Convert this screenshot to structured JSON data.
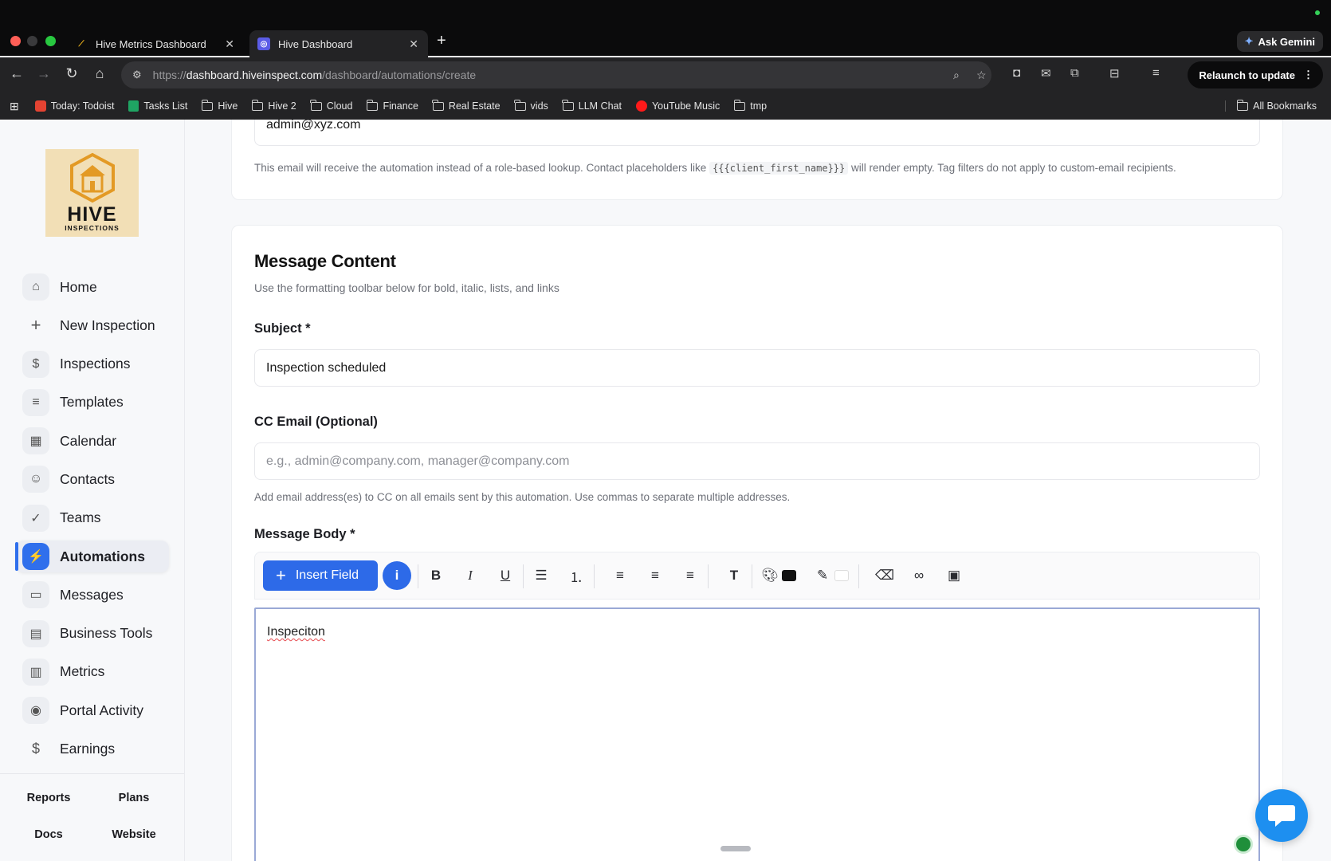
{
  "browser": {
    "tabs": [
      {
        "title": "Hive Metrics Dashboard",
        "active": false
      },
      {
        "title": "Hive Dashboard",
        "active": true
      }
    ],
    "ask_gemini": "Ask Gemini",
    "url_prefix": "https://",
    "url_domain": "dashboard.hiveinspect.com",
    "url_path": "/dashboard/automations/create",
    "relaunch": "Relaunch to update",
    "bookmarks": [
      {
        "label": "Today: Todoist",
        "icon": "todoist-icon"
      },
      {
        "label": "Tasks List",
        "icon": "sheets-icon"
      },
      {
        "label": "Hive",
        "icon": "folder-icon"
      },
      {
        "label": "Hive 2",
        "icon": "folder-icon"
      },
      {
        "label": "Cloud",
        "icon": "folder-icon"
      },
      {
        "label": "Finance",
        "icon": "folder-icon"
      },
      {
        "label": "Real Estate",
        "icon": "folder-icon"
      },
      {
        "label": "vids",
        "icon": "folder-icon"
      },
      {
        "label": "LLM Chat",
        "icon": "folder-icon"
      },
      {
        "label": "YouTube Music",
        "icon": "youtube-music-icon"
      },
      {
        "label": "tmp",
        "icon": "folder-icon"
      }
    ],
    "all_bookmarks": "All Bookmarks"
  },
  "sidebar": {
    "logo_word": "HIVE",
    "logo_sub": "INSPECTIONS",
    "items": [
      {
        "label": "Home",
        "icon": "home-icon",
        "glyph": "⌂"
      },
      {
        "label": "New Inspection",
        "icon": "plus-icon",
        "glyph": "+"
      },
      {
        "label": "Inspections",
        "icon": "dollar-doc-icon",
        "glyph": "$"
      },
      {
        "label": "Templates",
        "icon": "document-icon",
        "glyph": "≡"
      },
      {
        "label": "Calendar",
        "icon": "calendar-icon",
        "glyph": "▦"
      },
      {
        "label": "Contacts",
        "icon": "users-icon",
        "glyph": "☺"
      },
      {
        "label": "Teams",
        "icon": "user-check-icon",
        "glyph": "✓"
      },
      {
        "label": "Automations",
        "icon": "lightning-icon",
        "glyph": "⚡",
        "active": true
      },
      {
        "label": "Messages",
        "icon": "message-icon",
        "glyph": "▭"
      },
      {
        "label": "Business Tools",
        "icon": "briefcase-icon",
        "glyph": "▤"
      },
      {
        "label": "Metrics",
        "icon": "bar-chart-icon",
        "glyph": "▥"
      },
      {
        "label": "Portal Activity",
        "icon": "eye-icon",
        "glyph": "◉"
      },
      {
        "label": "Earnings",
        "icon": "dollar-icon",
        "glyph": "$"
      }
    ],
    "footer": {
      "reports": "Reports",
      "plans": "Plans",
      "docs": "Docs",
      "website": "Website"
    }
  },
  "recipient": {
    "custom_email_value": "admin@xyz.com",
    "helper_before": "This email will receive the automation instead of a role-based lookup. Contact placeholders like",
    "helper_code": "{{{client_first_name}}}",
    "helper_after": "will render empty. Tag filters do not apply to custom-email recipients."
  },
  "message": {
    "title": "Message Content",
    "subtitle": "Use the formatting toolbar below for bold, italic, lists, and links",
    "subject_label": "Subject *",
    "subject_value": "Inspection scheduled",
    "cc_label": "CC Email (Optional)",
    "cc_placeholder": "e.g., admin@company.com, manager@company.com",
    "cc_helper": "Add email address(es) to CC on all emails sent by this automation. Use commas to separate multiple addresses.",
    "body_label": "Message Body *",
    "insert_field": "Insert Field",
    "info": "i",
    "body_text": "Inspeciton"
  },
  "colors": {
    "accent": "#2d6ae8",
    "chat_fab": "#1d8ff0",
    "text_color_swatch": "#111111",
    "highlight_swatch": "#ffffff"
  }
}
